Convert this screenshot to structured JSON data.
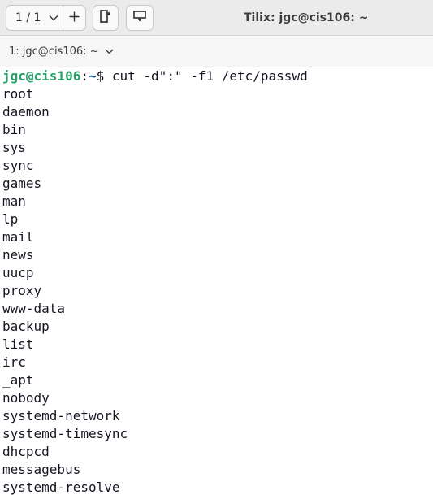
{
  "headerbar": {
    "session_switcher": "1 / 1",
    "window_title": "Tilix: jgc@cis106: ~"
  },
  "tab": {
    "terminal_title": "1: jgc@cis106: ~"
  },
  "terminal": {
    "prompt": {
      "user_host": "jgc@cis106",
      "separator": ":",
      "path": "~",
      "symbol": "$",
      "command": " cut -d\":\" -f1 /etc/passwd"
    },
    "output": [
      "root",
      "daemon",
      "bin",
      "sys",
      "sync",
      "games",
      "man",
      "lp",
      "mail",
      "news",
      "uucp",
      "proxy",
      "www-data",
      "backup",
      "list",
      "irc",
      "_apt",
      "nobody",
      "systemd-network",
      "systemd-timesync",
      "dhcpcd",
      "messagebus",
      "systemd-resolve"
    ]
  },
  "colors": {
    "prompt_user": "#26a269",
    "prompt_path": "#12488b",
    "text": "#171421",
    "background": "#ffffff"
  },
  "icons": [
    "chevron-down-icon",
    "plus-icon",
    "split-vertical-icon",
    "split-horizontal-icon"
  ]
}
